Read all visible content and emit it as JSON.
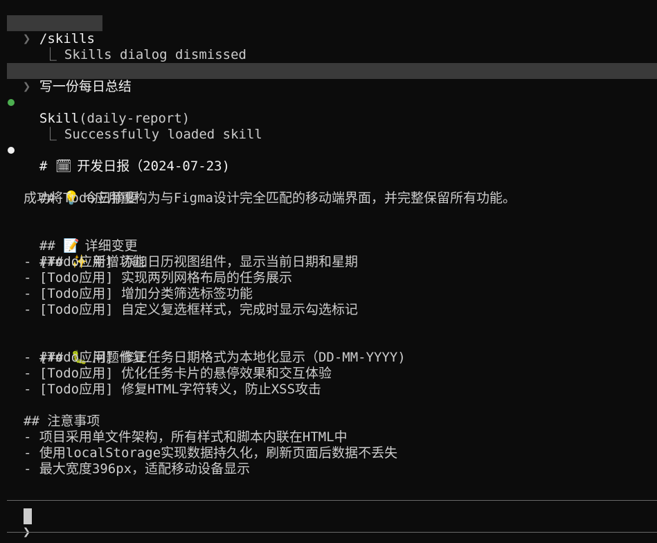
{
  "history": {
    "cmd1": {
      "chevron": "❯",
      "text": "/skills "
    },
    "cmd1_result": {
      "branch": "⎿",
      "text": "Skills dialog dismissed"
    },
    "cmd2": {
      "chevron": "❯",
      "text": "写一份每日总结"
    },
    "skill_call": {
      "name": "Skill",
      "args": "(daily-report)"
    },
    "skill_result": {
      "branch": "⎿",
      "text": "Successfully loaded skill"
    }
  },
  "report": {
    "title_prefix": "# ",
    "title_icon": "🗓",
    "title_text": " 开发日报（2024-07-23)",
    "summary_heading_prefix": "## ",
    "summary_icon": "💡",
    "summary_heading": " 今日摘要",
    "summary_text": "成功将Todo应用重构为与Figma设计完全匹配的移动端界面，并完整保留所有功能。",
    "changes_heading_prefix": "## ",
    "changes_icon": "📝",
    "changes_heading": " 详细变更",
    "features_heading_prefix": "### ",
    "features_icon": "✨",
    "features_heading": " 新增功能",
    "features": [
      "- [Todo应用] 添加日历视图组件，显示当前日期和星期",
      "- [Todo应用] 实现两列网格布局的任务展示",
      "- [Todo应用] 增加分类筛选标签功能",
      "- [Todo应用] 自定义复选框样式，完成时显示勾选标记"
    ],
    "fixes_heading_prefix": "### ",
    "fixes_icon": "🐛",
    "fixes_heading": " 问题修复",
    "fixes": [
      "- [Todo应用] 修正任务日期格式为本地化显示（DD-MM-YYYY)",
      "- [Todo应用] 优化任务卡片的悬停效果和交互体验",
      "- [Todo应用] 修复HTML字符转义，防止XSS攻击"
    ],
    "notes_heading": "## 注意事项",
    "notes": [
      "- 项目采用单文件架构，所有样式和脚本内联在HTML中",
      "- 使用localStorage实现数据持久化，刷新页面后数据不丢失",
      "- 最大宽度396px，适配移动设备显示"
    ]
  },
  "input": {
    "chevron": "❯",
    "value": ""
  },
  "colors": {
    "background": "#0c0c0c",
    "prompt_bar": "#3a3a3a",
    "success_dot": "#4caf50",
    "text": "#cccccc"
  }
}
